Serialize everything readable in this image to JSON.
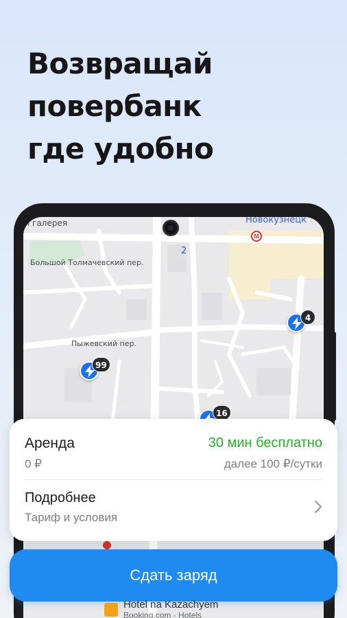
{
  "headline": {
    "line1": "Возвращай",
    "line2": "повербанк",
    "line3": "где удобно"
  },
  "map": {
    "labels": {
      "gallery": "ı галерея",
      "metro_station": "Новокузнецк",
      "street1": "Большой Толмачевский пер.",
      "street2": "Пыжевский пер.",
      "metro_num": "2"
    },
    "pins": [
      {
        "count": "4"
      },
      {
        "count": "99"
      },
      {
        "count": "16"
      }
    ],
    "hotel": {
      "name": "Hotel na Kazachyem",
      "sub": "Booking.com - Hotels"
    }
  },
  "card": {
    "rent_title": "Аренда",
    "rent_free": "30 мин бесплатно",
    "rent_price": "0 ₽",
    "rent_after": "далее 100 ₽/сутки",
    "more_title": "Подробнее",
    "more_sub": "Тариф и условия"
  },
  "cta": {
    "label": "Сдать заряд"
  },
  "colors": {
    "accent": "#1f8bf0",
    "free_green": "#22b322",
    "pin_blue": "#1a73e8"
  }
}
